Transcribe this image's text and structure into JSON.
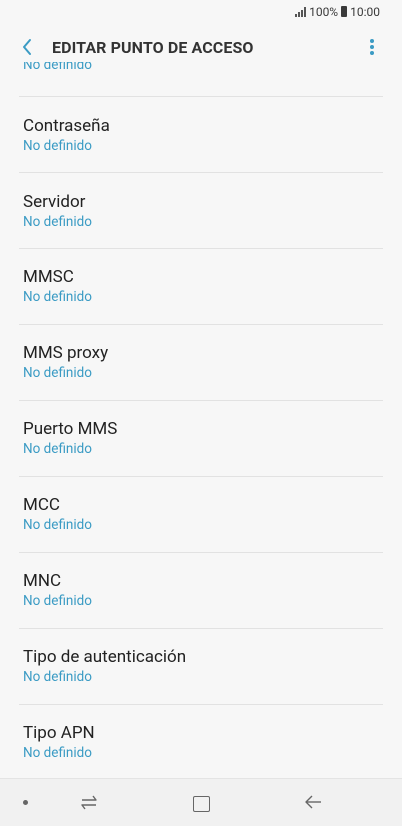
{
  "status_bar": {
    "battery": "100%",
    "time": "10:00"
  },
  "header": {
    "title": "EDITAR PUNTO DE ACCESO"
  },
  "partial_item": {
    "value": "No definido"
  },
  "items": [
    {
      "label": "Contraseña",
      "value": "No definido"
    },
    {
      "label": "Servidor",
      "value": "No definido"
    },
    {
      "label": "MMSC",
      "value": "No definido"
    },
    {
      "label": "MMS proxy",
      "value": "No definido"
    },
    {
      "label": "Puerto MMS",
      "value": "No definido"
    },
    {
      "label": "MCC",
      "value": "No definido"
    },
    {
      "label": "MNC",
      "value": "No definido"
    },
    {
      "label": "Tipo de autenticación",
      "value": "No definido"
    },
    {
      "label": "Tipo APN",
      "value": "No definido"
    }
  ],
  "colors": {
    "accent_value": "#3b9bc4",
    "title": "#333333",
    "background": "#f7f7f7"
  },
  "icons": {
    "back": "chevron-left-icon",
    "more": "more-vertical-icon"
  }
}
